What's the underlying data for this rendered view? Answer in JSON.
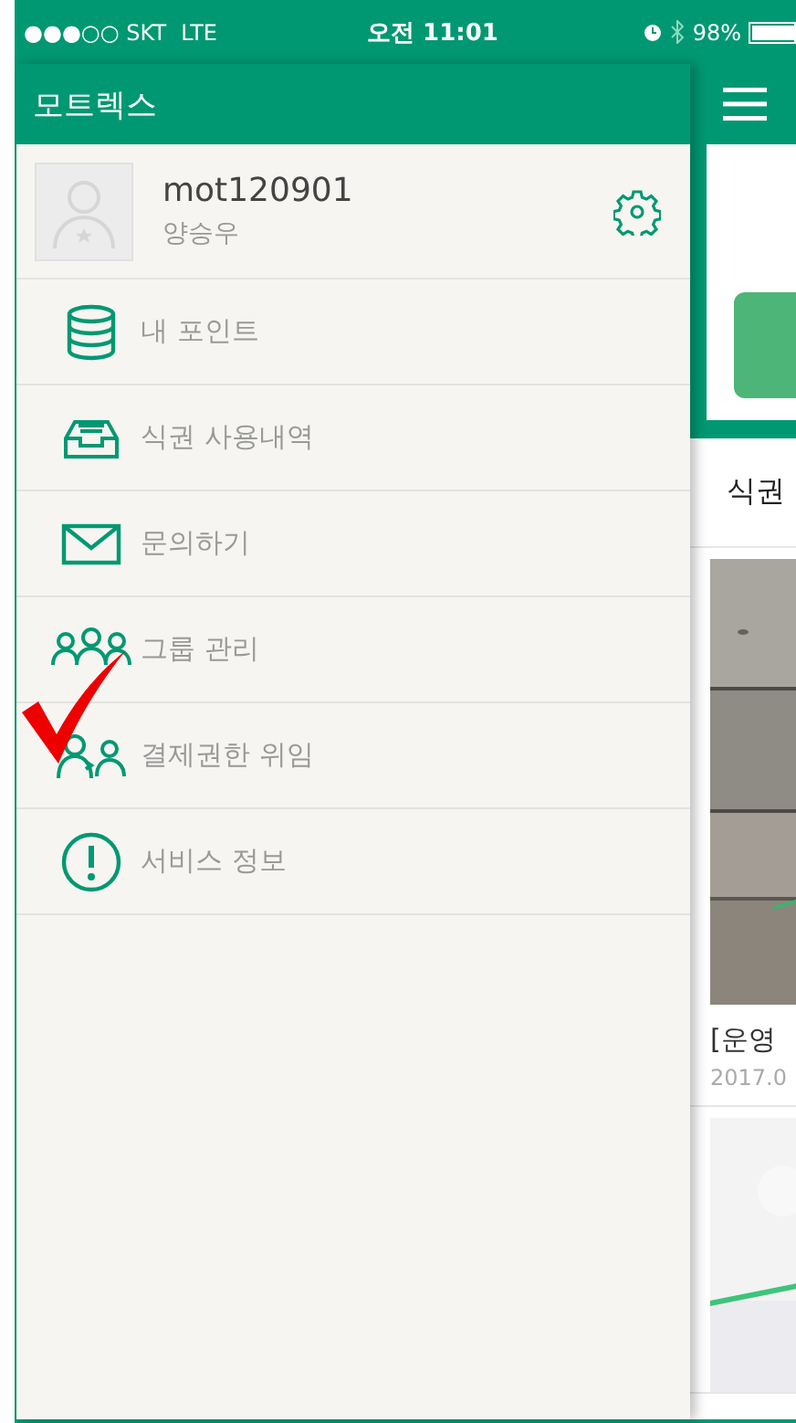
{
  "status_bar": {
    "carrier": "●●●○○ SKT",
    "network": "LTE",
    "time": "오전 11:01",
    "battery": "98%"
  },
  "drawer": {
    "title": "모트렉스",
    "profile": {
      "user_id": "mot120901",
      "name": "양승우"
    },
    "menu": [
      {
        "label": "내 포인트",
        "kind": "database"
      },
      {
        "label": "식권 사용내역",
        "kind": "inbox"
      },
      {
        "label": "문의하기",
        "kind": "mail"
      },
      {
        "label": "그룹 관리",
        "kind": "group"
      },
      {
        "label": "결제권한 위임",
        "kind": "delegate"
      },
      {
        "label": "서비스 정보",
        "kind": "info"
      }
    ]
  },
  "main": {
    "section_title": "식권",
    "posts": [
      {
        "kind": "picture",
        "title": "[운영",
        "date": "2017.0"
      },
      {
        "kind": "picture"
      }
    ]
  }
}
